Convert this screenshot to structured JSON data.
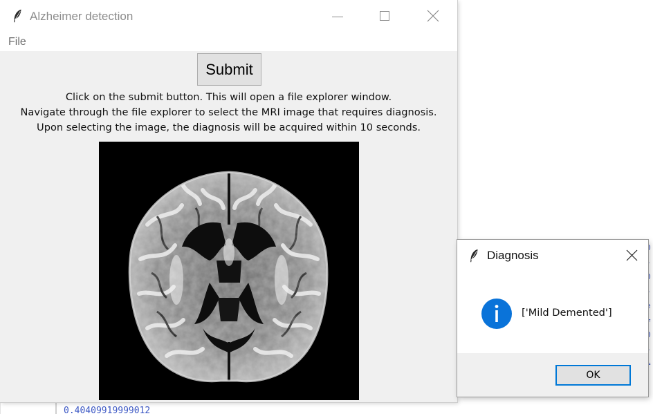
{
  "main_window": {
    "title": "Alzheimer detection",
    "menu": {
      "file_label": "File"
    },
    "submit_label": "Submit",
    "instructions": [
      "Click on the submit button. This will open a file explorer window.",
      "Navigate through the file explorer to select the MRI image that requires diagnosis.",
      "Upon selecting the image, the diagnosis will be acquired within 10 seconds."
    ]
  },
  "dialog": {
    "title": "Diagnosis",
    "message": "['Mild Demented']",
    "ok_label": "OK",
    "icon": "info-icon"
  },
  "background_console": {
    "partial_text": "0.40409919999012"
  },
  "colors": {
    "accent": "#0078d7",
    "info_icon": "#0a73d9",
    "window_bg": "#f0f0f0",
    "console_text": "#3b57c4"
  }
}
